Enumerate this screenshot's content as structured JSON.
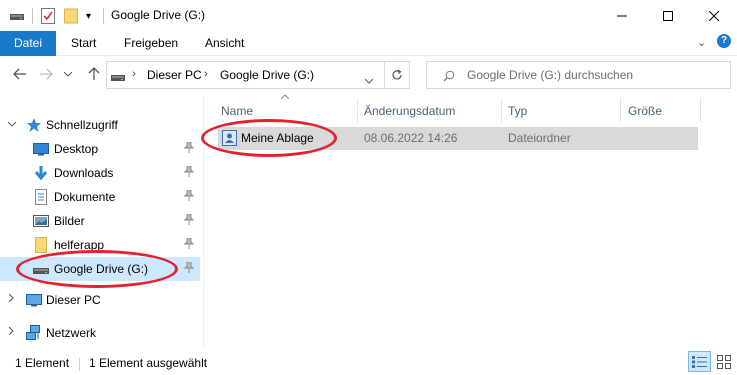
{
  "window": {
    "title": "Google Drive (G:)",
    "controls": {
      "minimize": "—",
      "maximize": "☐",
      "close": "✕"
    }
  },
  "quick_access_toolbar": {
    "dropdown_glyph": "▾"
  },
  "ribbon": {
    "tabs": [
      {
        "label": "Datei",
        "active": true
      },
      {
        "label": "Start",
        "active": false
      },
      {
        "label": "Freigeben",
        "active": false
      },
      {
        "label": "Ansicht",
        "active": false
      }
    ],
    "collapse_glyph": "⌄",
    "help_glyph": "?"
  },
  "navigation": {
    "back": "←",
    "forward": "→",
    "recent": "⌄",
    "up": "↑"
  },
  "address_bar": {
    "segments": [
      "Dieser PC",
      "Google Drive (G:)"
    ],
    "separator": "›",
    "dropdown_glyph": "⌄",
    "refresh_glyph": "↻"
  },
  "search": {
    "placeholder": "Google Drive (G:) durchsuchen",
    "icon": "search-icon"
  },
  "nav_pane": {
    "items": [
      {
        "label": "Schnellzugriff",
        "icon": "star-icon",
        "expanded": true
      },
      {
        "label": "Desktop",
        "icon": "desktop-icon",
        "pinned": true
      },
      {
        "label": "Downloads",
        "icon": "download-arrow-icon",
        "pinned": true
      },
      {
        "label": "Dokumente",
        "icon": "document-icon",
        "pinned": true
      },
      {
        "label": "Bilder",
        "icon": "pictures-icon",
        "pinned": true
      },
      {
        "label": "helferapp",
        "icon": "folder-icon",
        "pinned": true
      },
      {
        "label": "Google Drive (G:)",
        "icon": "drive-icon",
        "pinned": true,
        "selected": true
      },
      {
        "label": "Dieser PC",
        "icon": "computer-icon",
        "expanded": false
      },
      {
        "label": "Netzwerk",
        "icon": "network-icon",
        "expanded": false
      }
    ],
    "chevron_expanded": "⌄",
    "chevron_collapsed": "›",
    "pin_glyph": "📌"
  },
  "file_list": {
    "columns": [
      "Name",
      "Änderungsdatum",
      "Typ",
      "Größe"
    ],
    "sort_indicator": "⌃",
    "rows": [
      {
        "name": "Meine Ablage",
        "modified": "08.06.2022 14:26",
        "type": "Dateiordner",
        "size": "",
        "icon": "shared-folder-icon"
      }
    ]
  },
  "status_bar": {
    "item_count": "1 Element",
    "selected": "1 Element ausgewählt"
  },
  "annotations": {
    "highlight_color": "#e2222d"
  },
  "colors": {
    "accent": "#1979ca",
    "selection": "#cce8ff",
    "row_highlight": "#d9d9d9",
    "folder": "#f8d775"
  }
}
